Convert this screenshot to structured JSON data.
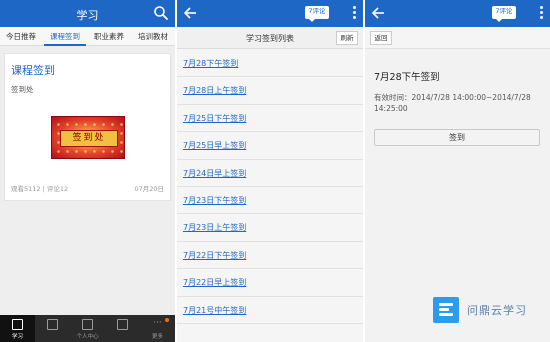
{
  "panel1": {
    "title": "学习",
    "tabs": [
      "今日推荐",
      "课程签到",
      "职业素养",
      "培训教材"
    ],
    "card": {
      "title": "课程签到",
      "subtitle": "签到处",
      "banner_text": "签到处",
      "meta": "观看5112 | 评论12",
      "date": "07月20日"
    },
    "bottom_nav": [
      "学习",
      "",
      "个人中心",
      "",
      "更多"
    ]
  },
  "panel2": {
    "comment_badge": "7评论",
    "list_title": "学习签到列表",
    "refresh_label": "刷新",
    "items": [
      "7月28下午签到",
      "7月28日上午签到",
      "7月25日下午签到",
      "7月25日早上签到",
      "7月24日早上签到",
      "7月23日下午签到",
      "7月23日上午签到",
      "7月22日下午签到",
      "7月22日早上签到",
      "7月21号中午签到"
    ]
  },
  "panel3": {
    "comment_badge": "7评论",
    "back_label": "返回",
    "title": "7月28下午签到",
    "time": "有效时间：2014/7/28 14:00:00~2014/7/28 14:25:00",
    "signin_label": "签到"
  },
  "watermark": {
    "text": "问鼎云学习"
  },
  "colors": {
    "accent": "#1f67c4",
    "nav_bg": "#2b2b2b",
    "badge": "#ff6a00"
  }
}
